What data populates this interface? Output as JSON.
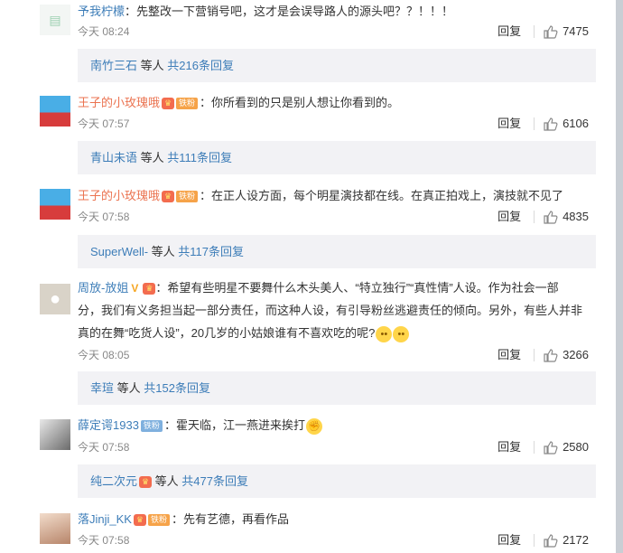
{
  "comments": [
    {
      "user": "予我柠檬",
      "text": "：先整改一下营销号吧，这才是会误导路人的源头吧？？！！！",
      "time": "今天 08:24",
      "reply": "回复",
      "likes": "7475",
      "sub": {
        "who": "南竹三石",
        "mid": " 等人 ",
        "more": "共216条回复"
      }
    },
    {
      "user": "王子的小玫瑰哦",
      "badge": "铁粉",
      "text": "：你所看到的只是别人想让你看到的。",
      "time": "今天 07:57",
      "reply": "回复",
      "likes": "6106",
      "sub": {
        "who": "青山未语",
        "mid": " 等人 ",
        "more": "共111条回复"
      }
    },
    {
      "user": "王子的小玫瑰哦",
      "badge": "铁粉",
      "text": "：在正人设方面，每个明星演技都在线。在真正拍戏上，演技就不见了",
      "time": "今天 07:58",
      "reply": "回复",
      "likes": "4835",
      "sub": {
        "who": "SuperWell-",
        "mid": " 等人 ",
        "more": "共117条回复"
      }
    },
    {
      "user": "周放-放姐",
      "text_1": "：希望有些明星不要舞什么木头美人、“特立独行”“真性情”人设。作为社会一部",
      "text_2": "分，我们有义务担当起一部分责任，而这种人设，有引导粉丝逃避责任的倾向。另外，有些人并非",
      "text_3": "真的在舞“吃货人设”，20几岁的小姑娘谁有不喜欢吃的呢?",
      "time": "今天 08:05",
      "reply": "回复",
      "likes": "3266",
      "sub": {
        "who": "幸瑄",
        "mid": " 等人 ",
        "more": "共152条回复"
      }
    },
    {
      "user": "薛定谔1933",
      "badge": "铁粉",
      "text": "：霍天临，江一燕进来挨打",
      "time": "今天 07:58",
      "reply": "回复",
      "likes": "2580",
      "sub": {
        "who": "纯二次元",
        "mid": " 等人 ",
        "more": "共477条回复"
      }
    },
    {
      "user": "落Jinji_KK",
      "badge": "铁粉",
      "text": "：先有艺德，再看作品",
      "time": "今天 07:58",
      "reply": "回复",
      "likes": "2172"
    }
  ],
  "colors": {
    "link": "#3d7db8",
    "name_orange": "#eb7350",
    "subbg": "#f2f2f5"
  },
  "icons": [
    "thumbs-up-icon",
    "crown-icon",
    "v-verified-icon",
    "emoji-icon"
  ]
}
